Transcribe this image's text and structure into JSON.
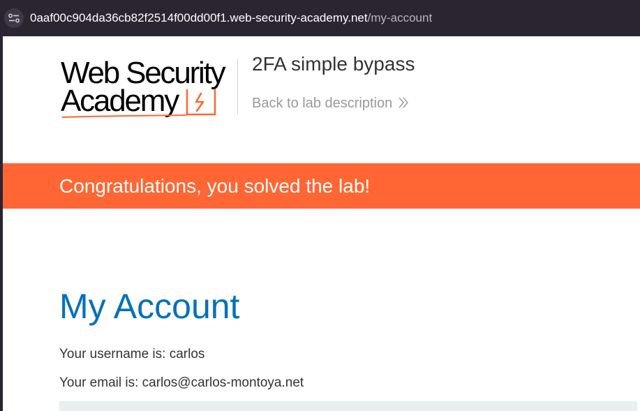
{
  "browser": {
    "url_host": "0aaf00c904da36cb82f2514f00dd00f1.web-security-academy.net",
    "url_path": "/my-account",
    "site_info_icon": "tune-icon"
  },
  "header": {
    "logo_line1": "Web Security",
    "logo_line2": "Academy",
    "lab_title": "2FA simple bypass",
    "back_link": "Back to lab description",
    "back_icon": "double-chevron-right-icon",
    "accent_color": "#ff6633"
  },
  "banner": {
    "message": "Congratulations, you solved the lab!",
    "color": "#ff6633"
  },
  "main": {
    "heading": "My Account",
    "heading_color": "#0071bc",
    "username_line": "Your username is: carlos",
    "email_line": "Your email is: carlos@carlos-montoya.net"
  }
}
